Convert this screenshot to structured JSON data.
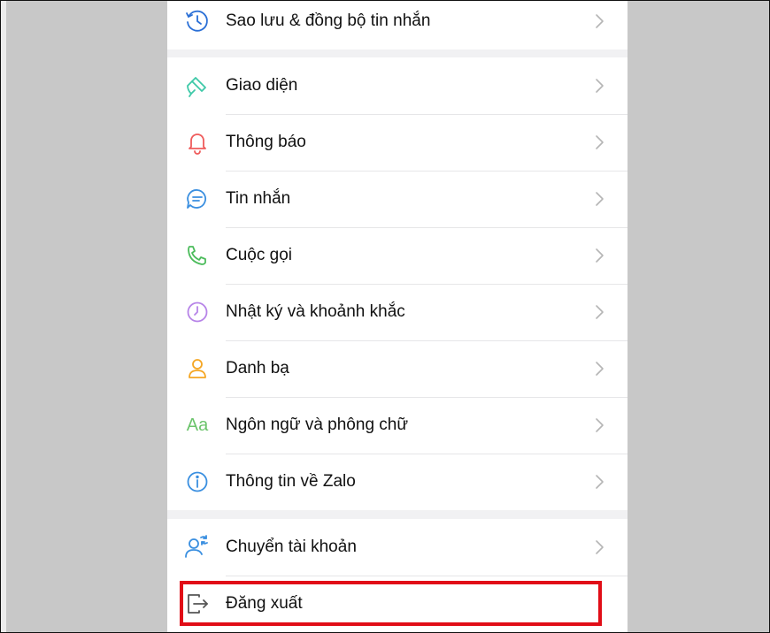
{
  "colors": {
    "highlight": "#e10d17",
    "sync_icon": "#2a6fd6",
    "theme_icon": "#3ec9a8",
    "notify_icon": "#ef5b5b",
    "message_icon": "#3a8fe0",
    "call_icon": "#4cbc5c",
    "diary_icon": "#b784e8",
    "contacts_icon": "#f5a623",
    "language_icon": "#6cc46c",
    "info_icon": "#3a8fe0",
    "switch_icon": "#3a8fe0",
    "logout_icon": "#555555"
  },
  "settings": {
    "items": [
      {
        "label": "Sao lưu & đồng bộ tin nhắn",
        "icon": "backup-clock-icon"
      },
      {
        "label": "Giao diện",
        "icon": "paint-brush-icon"
      },
      {
        "label": "Thông báo",
        "icon": "bell-icon"
      },
      {
        "label": "Tin nhắn",
        "icon": "chat-bubble-icon"
      },
      {
        "label": "Cuộc gọi",
        "icon": "phone-icon"
      },
      {
        "label": "Nhật ký và khoảnh khắc",
        "icon": "timeline-clock-icon"
      },
      {
        "label": "Danh bạ",
        "icon": "person-icon"
      },
      {
        "label": "Ngôn ngữ và phông chữ",
        "icon": "font-aa-icon",
        "icon_text": "Aa"
      },
      {
        "label": "Thông tin về Zalo",
        "icon": "info-circle-icon"
      },
      {
        "label": "Chuyển tài khoản",
        "icon": "switch-account-icon"
      },
      {
        "label": "Đăng xuất",
        "icon": "logout-icon"
      }
    ]
  }
}
